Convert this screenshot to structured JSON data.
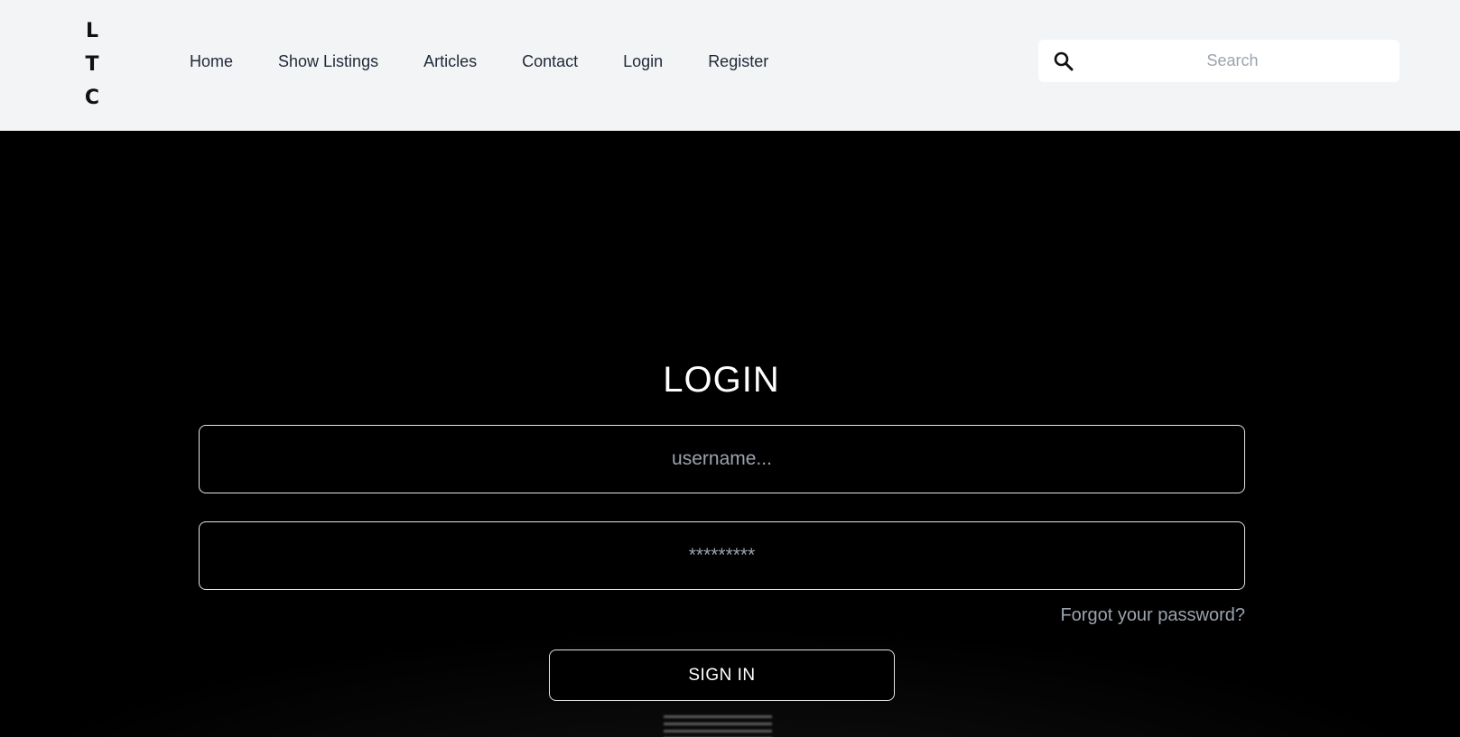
{
  "logo": {
    "letters": [
      "L",
      "T",
      "C"
    ]
  },
  "nav": {
    "items": [
      {
        "label": "Home"
      },
      {
        "label": "Show Listings"
      },
      {
        "label": "Articles"
      },
      {
        "label": "Contact"
      },
      {
        "label": "Login"
      },
      {
        "label": "Register"
      }
    ]
  },
  "search": {
    "placeholder": "Search",
    "icon": "search-icon"
  },
  "login": {
    "title": "LOGIN",
    "username_placeholder": "username...",
    "password_placeholder": "*********",
    "forgot_label": "Forgot your password?",
    "signin_label": "SIGN IN"
  },
  "colors": {
    "header_bg": "#f3f4f6",
    "hero_bg": "#000000",
    "placeholder": "#9ca3af",
    "text_light": "#ffffff"
  }
}
